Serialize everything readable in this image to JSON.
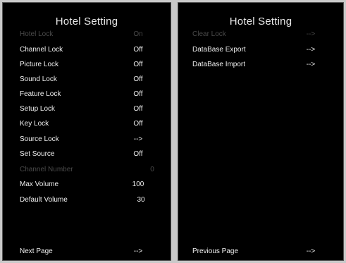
{
  "left": {
    "title": "Hotel  Setting",
    "items": [
      {
        "label": "Hotel Lock",
        "value": "On",
        "disabled": true
      },
      {
        "label": "Channel Lock",
        "value": "Off",
        "disabled": false
      },
      {
        "label": "Picture Lock",
        "value": "Off",
        "disabled": false
      },
      {
        "label": "Sound Lock",
        "value": "Off",
        "disabled": false
      },
      {
        "label": "Feature Lock",
        "value": "Off",
        "disabled": false
      },
      {
        "label": "Setup Lock",
        "value": "Off",
        "disabled": false
      },
      {
        "label": "Key Lock",
        "value": "Off",
        "disabled": false
      },
      {
        "label": "Source Lock",
        "value": "-->",
        "disabled": false
      },
      {
        "label": "Set Source",
        "value": "Off",
        "disabled": false
      },
      {
        "label": "Channel Number",
        "value": "0",
        "disabled": true
      },
      {
        "label": "Max Volume",
        "value": "100",
        "disabled": false
      },
      {
        "label": "Default Volume",
        "value": "30",
        "disabled": false
      }
    ],
    "footer": {
      "label": "Next Page",
      "value": "-->"
    }
  },
  "right": {
    "title": "Hotel  Setting",
    "items": [
      {
        "label": "Clear Lock",
        "value": "-->",
        "disabled": true
      },
      {
        "label": "DataBase Export",
        "value": "-->",
        "disabled": false
      },
      {
        "label": "DataBase Import",
        "value": "-->",
        "disabled": false
      }
    ],
    "footer": {
      "label": "Previous Page",
      "value": "-->"
    }
  }
}
